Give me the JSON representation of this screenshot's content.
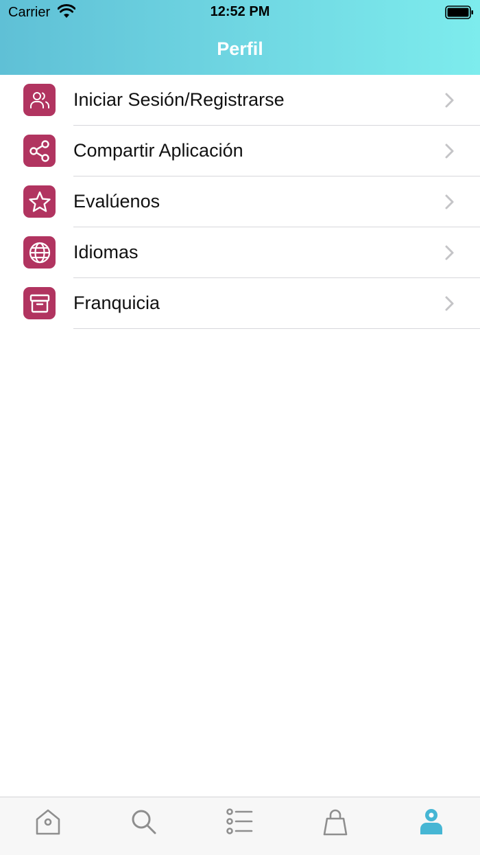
{
  "status_bar": {
    "carrier": "Carrier",
    "time": "12:52 PM",
    "wifi_icon": "wifi-icon",
    "battery_icon": "battery-icon"
  },
  "header": {
    "title": "Perfil"
  },
  "menu": {
    "items": [
      {
        "label": "Iniciar Sesión/Registrarse",
        "icon": "users-icon"
      },
      {
        "label": "Compartir Aplicación",
        "icon": "share-icon"
      },
      {
        "label": "Evalúenos",
        "icon": "star-icon"
      },
      {
        "label": "Idiomas",
        "icon": "globe-icon"
      },
      {
        "label": "Franquicia",
        "icon": "store-icon"
      }
    ]
  },
  "tab_bar": {
    "items": [
      {
        "icon": "home-tag-icon",
        "active": false
      },
      {
        "icon": "search-icon",
        "active": false
      },
      {
        "icon": "list-icon",
        "active": false
      },
      {
        "icon": "shopping-bag-icon",
        "active": false
      },
      {
        "icon": "profile-icon",
        "active": true
      }
    ]
  },
  "colors": {
    "header_gradient_start": "#5fc0d6",
    "header_gradient_end": "#7deced",
    "icon_bg": "#b13460",
    "tab_active": "#46b6d4",
    "tab_inactive": "#8e8e8e"
  }
}
